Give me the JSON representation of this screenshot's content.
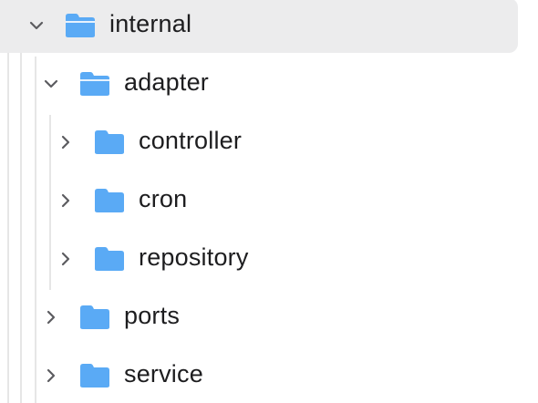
{
  "tree": {
    "root": {
      "label": "internal",
      "expanded": true,
      "selected": true,
      "icon": "folder-open-icon"
    },
    "children": [
      {
        "label": "adapter",
        "expanded": true,
        "icon": "folder-open-icon",
        "children": [
          {
            "label": "controller",
            "expanded": false,
            "icon": "folder-icon"
          },
          {
            "label": "cron",
            "expanded": false,
            "icon": "folder-icon"
          },
          {
            "label": "repository",
            "expanded": false,
            "icon": "folder-icon"
          }
        ]
      },
      {
        "label": "ports",
        "expanded": false,
        "icon": "folder-icon"
      },
      {
        "label": "service",
        "expanded": false,
        "icon": "folder-icon"
      }
    ]
  },
  "colors": {
    "folder": "#5aaaf5",
    "folder_dark": "#3d97ef",
    "chevron": "#5c5c60",
    "selection": "#ececed",
    "guide": "#e6e6e6",
    "text": "#1d1d1f"
  }
}
